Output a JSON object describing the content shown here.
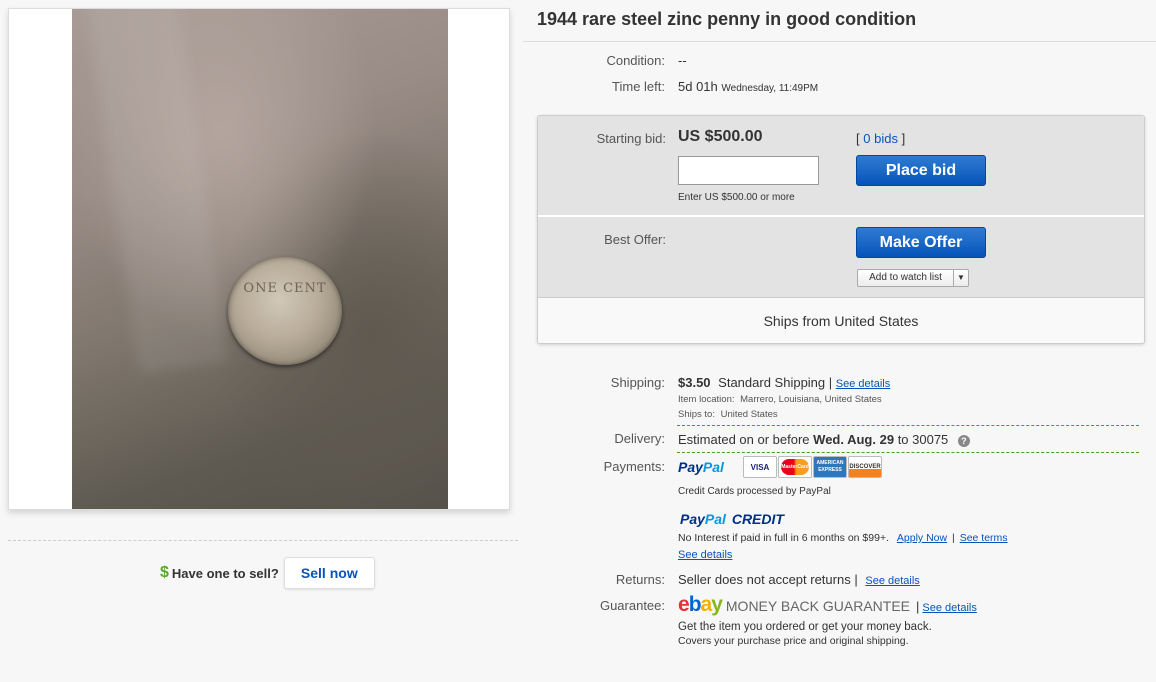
{
  "listing": {
    "title": "1944 rare steel zinc penny in good condition",
    "coin_text": "ONE CENT"
  },
  "details": {
    "condition_label": "Condition:",
    "condition_value": "--",
    "time_left_label": "Time left:",
    "time_left_value": "5d 01h",
    "time_left_end": "Wednesday, 11:49PM"
  },
  "bid": {
    "starting_bid_label": "Starting bid:",
    "starting_bid_value": "US $500.00",
    "bids_open": "[",
    "bids_link": "0 bids",
    "bids_close": "]",
    "input_value": "",
    "input_hint": "Enter US $500.00 or more",
    "place_bid_label": "Place bid",
    "best_offer_label": "Best Offer:",
    "make_offer_label": "Make Offer",
    "watch_label": "Add to watch list",
    "ships_from": "Ships from United States"
  },
  "shipping": {
    "label": "Shipping:",
    "price": "$3.50",
    "method": "Standard Shipping",
    "see_details": "See details",
    "location_label": "Item location:",
    "location_value": "Marrero, Louisiana, United States",
    "ships_to_label": "Ships to:",
    "ships_to_value": "United States"
  },
  "delivery": {
    "label": "Delivery:",
    "prefix": "Estimated on or before",
    "date": "Wed. Aug. 29",
    "suffix": "to 30075"
  },
  "payments": {
    "label": "Payments:",
    "paypal_a": "Pay",
    "paypal_b": "Pal",
    "cards": [
      "VISA",
      "MasterCard",
      "AMERICAN EXPRESS",
      "DISCOVER"
    ],
    "cards_note": "Credit Cards processed by PayPal",
    "credit_a": "Pay",
    "credit_b": "Pal",
    "credit_c": "CREDIT",
    "credit_note": "No Interest if paid in full in 6 months on $99+.",
    "apply_now": "Apply Now",
    "see_terms": "See terms",
    "see_details": "See details"
  },
  "returns": {
    "label": "Returns:",
    "value": "Seller does not accept returns",
    "see_details": "See details"
  },
  "guarantee": {
    "label": "Guarantee:",
    "ebay_e": "e",
    "ebay_b": "b",
    "ebay_a": "a",
    "ebay_y": "y",
    "mbg": "MONEY BACK GUARANTEE",
    "see_details": "See details",
    "line1": "Get the item you ordered or get your money back.",
    "line2": "Covers your purchase price and original shipping."
  },
  "sell": {
    "dollar": "$",
    "question": "Have one to sell?",
    "button": "Sell now"
  },
  "colors": {
    "link": "#0654ba",
    "button_blue": "#0654ba",
    "dollar_green": "#5ba829",
    "ebay_red": "#e53238",
    "ebay_blue": "#0064d2",
    "ebay_yellow": "#f5af02",
    "ebay_green": "#86b817"
  }
}
